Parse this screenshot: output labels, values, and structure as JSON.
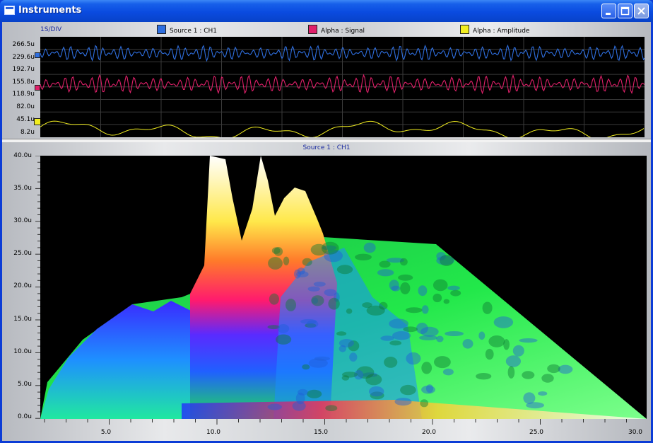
{
  "window": {
    "title": "Instruments"
  },
  "top_panel": {
    "div_label": "1S/DIV",
    "legend": [
      {
        "label": "Source 1 : CH1",
        "color": "#2f6fe0"
      },
      {
        "label": "Alpha : Signal",
        "color": "#e0206a"
      },
      {
        "label": "Alpha : Amplitude",
        "color": "#f2ee20"
      }
    ],
    "y_ticks": [
      "266.5u",
      "229.6u",
      "192.7u",
      "155.8u",
      "118.9u",
      "82.0u",
      "45.1u",
      "8.2u"
    ]
  },
  "bottom_panel": {
    "title": "Source 1 : CH1",
    "y_ticks": [
      "40.0u",
      "35.0u",
      "30.0u",
      "25.0u",
      "20.0u",
      "15.0u",
      "10.0u",
      "5.0u",
      "0.0u"
    ],
    "x_ticks": [
      "5.0",
      "10.0",
      "15.0",
      "20.0",
      "25.0",
      "30.0"
    ]
  },
  "colors": {
    "blue_trace": "#2f6fe0",
    "red_trace": "#e0206a",
    "yellow_trace": "#f2ee20"
  }
}
